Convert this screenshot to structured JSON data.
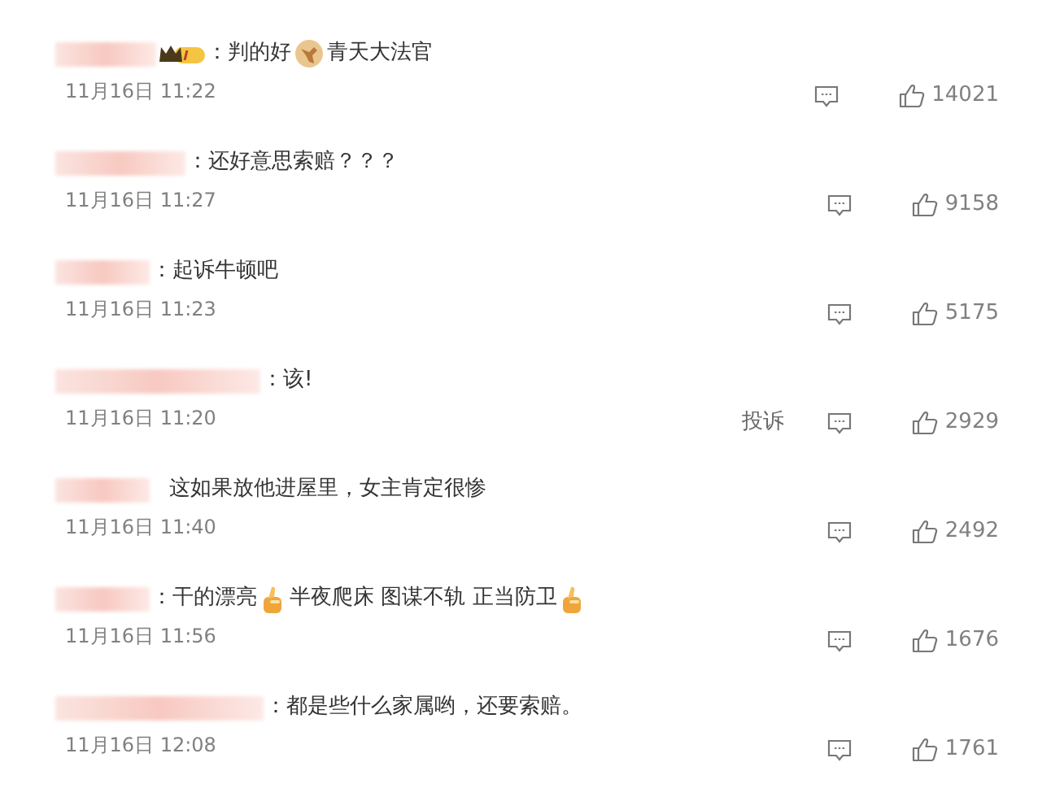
{
  "comments": [
    {
      "badge": true,
      "parts": [
        {
          "kind": "text",
          "text": "：判的好"
        },
        {
          "kind": "emoji-hammer"
        },
        {
          "kind": "text",
          "text": "青天大法官"
        }
      ],
      "time": "11月16日 11:22",
      "likes": "14021"
    },
    {
      "badge": false,
      "parts": [
        {
          "kind": "text",
          "text": "：还好意思索赔？？？"
        }
      ],
      "time": "11月16日 11:27",
      "likes": "9158"
    },
    {
      "badge": false,
      "parts": [
        {
          "kind": "text",
          "text": "：起诉牛顿吧"
        }
      ],
      "time": "11月16日 11:23",
      "likes": "5175"
    },
    {
      "badge": false,
      "parts": [
        {
          "kind": "text",
          "text": "：该!"
        }
      ],
      "time": "11月16日 11:20",
      "report_label": "投诉",
      "likes": "2929"
    },
    {
      "badge": false,
      "parts": [
        {
          "kind": "text",
          "text": "这如果放他进屋里，女主肯定很惨"
        }
      ],
      "time": "11月16日 11:40",
      "likes": "2492"
    },
    {
      "badge": false,
      "parts": [
        {
          "kind": "text",
          "text": "：干的漂亮"
        },
        {
          "kind": "emoji-thumb"
        },
        {
          "kind": "text",
          "text": "半夜爬床 图谋不轨 正当防卫"
        },
        {
          "kind": "emoji-thumb"
        }
      ],
      "time": "11月16日 11:56",
      "likes": "1676"
    },
    {
      "badge": false,
      "parts": [
        {
          "kind": "text",
          "text": "：都是些什么家属哟，还要索赔。"
        }
      ],
      "time": "11月16日 12:08",
      "likes": "1761"
    }
  ]
}
